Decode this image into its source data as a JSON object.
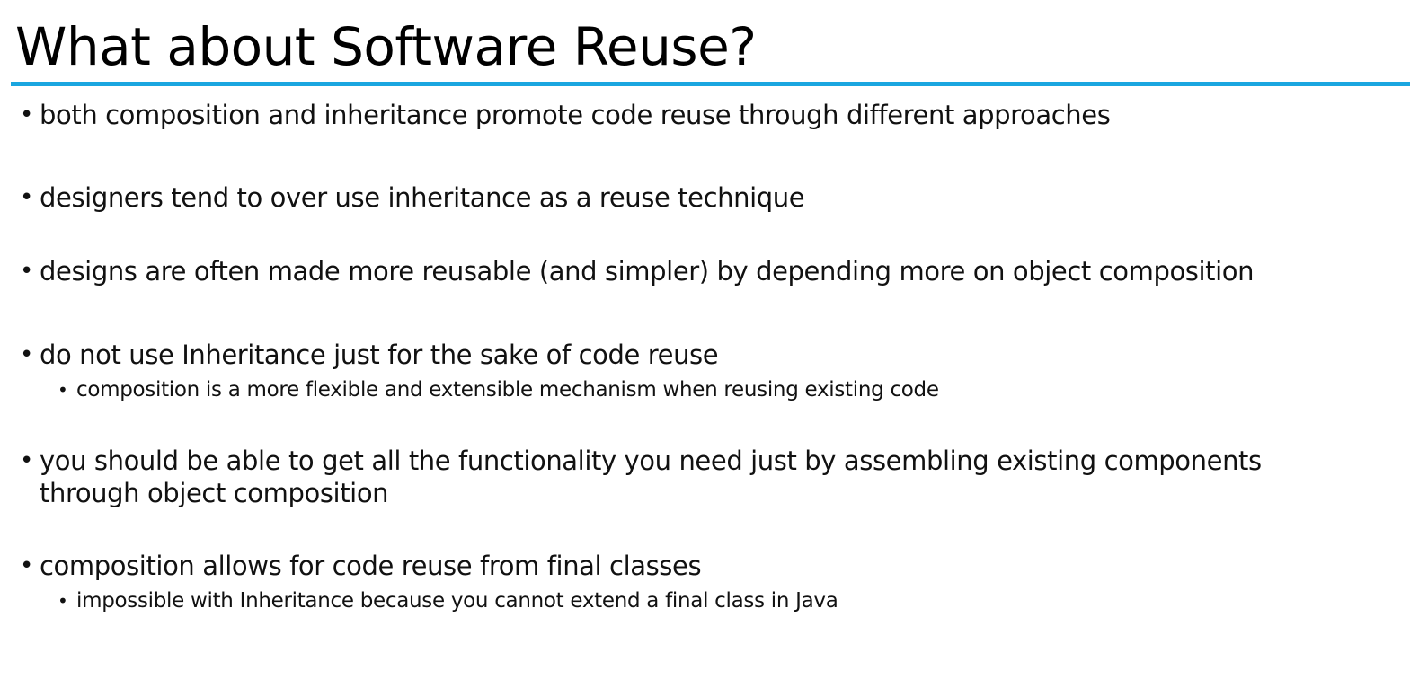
{
  "slide": {
    "title": "What about Software Reuse?",
    "accent_color": "#1aa6e0",
    "bullet_glyph": "•",
    "bullets": [
      {
        "text": "both composition and inheritance promote code reuse through different approaches"
      },
      {
        "text": "designers tend to over use inheritance as a reuse technique"
      },
      {
        "text": "designs are often made more reusable (and simpler) by depending more on object composition"
      },
      {
        "text": "do not use Inheritance just for the sake of code reuse",
        "sub": "composition is a more flexible and extensible mechanism when reusing existing code"
      },
      {
        "text_line1": "you should be able to get all the functionality you need just by assembling existing components",
        "text_line2": "through object composition"
      },
      {
        "text": "composition allows for code reuse from final classes",
        "sub": "impossible with Inheritance because you cannot extend a final class in Java"
      }
    ]
  }
}
